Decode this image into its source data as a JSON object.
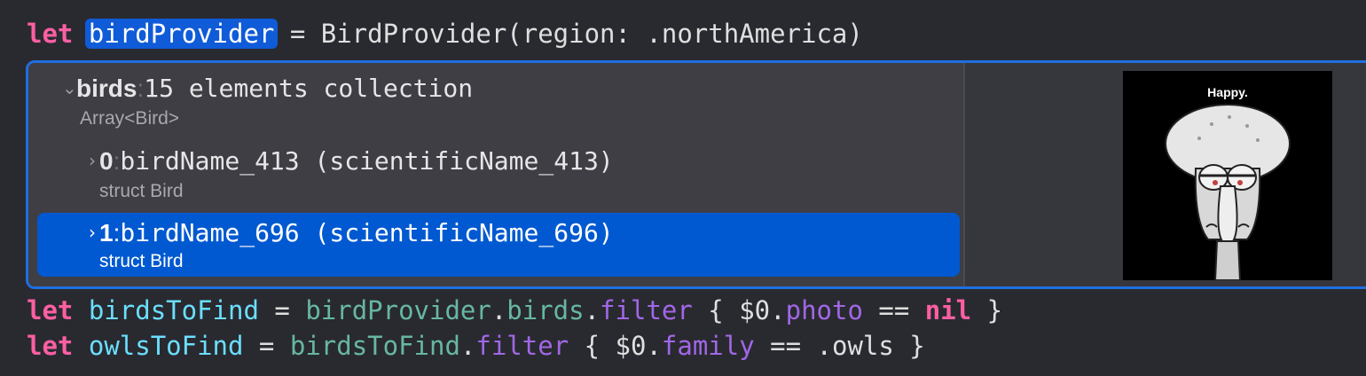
{
  "code": {
    "line1": {
      "keyword": "let",
      "var_name": "birdProvider",
      "equals": " = ",
      "type": "BirdProvider",
      "args": "(region: .northAmerica)"
    },
    "line2": {
      "keyword": "let",
      "var_name": "birdsToFind",
      "equals": " = ",
      "ref": "birdProvider",
      "dot1": ".",
      "prop": "birds",
      "dot2": ".",
      "method": "filter",
      "open": " { $0.",
      "member": "photo",
      "op": " == ",
      "nil": "nil",
      "close": " }"
    },
    "line3": {
      "keyword": "let",
      "var_name": "owlsToFind",
      "equals": " = ",
      "ref": "birdsToFind",
      "dot1": ".",
      "method": "filter",
      "open": " { $0.",
      "member": "family",
      "op": " == ",
      "value": ".owls",
      "close": " }"
    }
  },
  "inspector": {
    "root": {
      "chevron": "⌄",
      "name": "birds",
      "colon": ":",
      "summary": "15 elements collection",
      "type": "Array<Bird>"
    },
    "items": [
      {
        "chevron": "›",
        "index": "0",
        "colon": ":",
        "summary": "birdName_413 (scientificName_413)",
        "type": "struct Bird"
      },
      {
        "chevron": "›",
        "index": "1",
        "colon": ":",
        "summary": "birdName_696 (scientificName_696)",
        "type": "struct Bird"
      }
    ],
    "preview": {
      "caption": "Happy."
    }
  },
  "colors": {
    "background": "#292a30",
    "keyword": "#fc5fa3",
    "variable": "#6bdfff",
    "reference": "#67b7a4",
    "method": "#a167e6",
    "selection": "#0059d1",
    "popover_border": "#1e6fe0"
  }
}
